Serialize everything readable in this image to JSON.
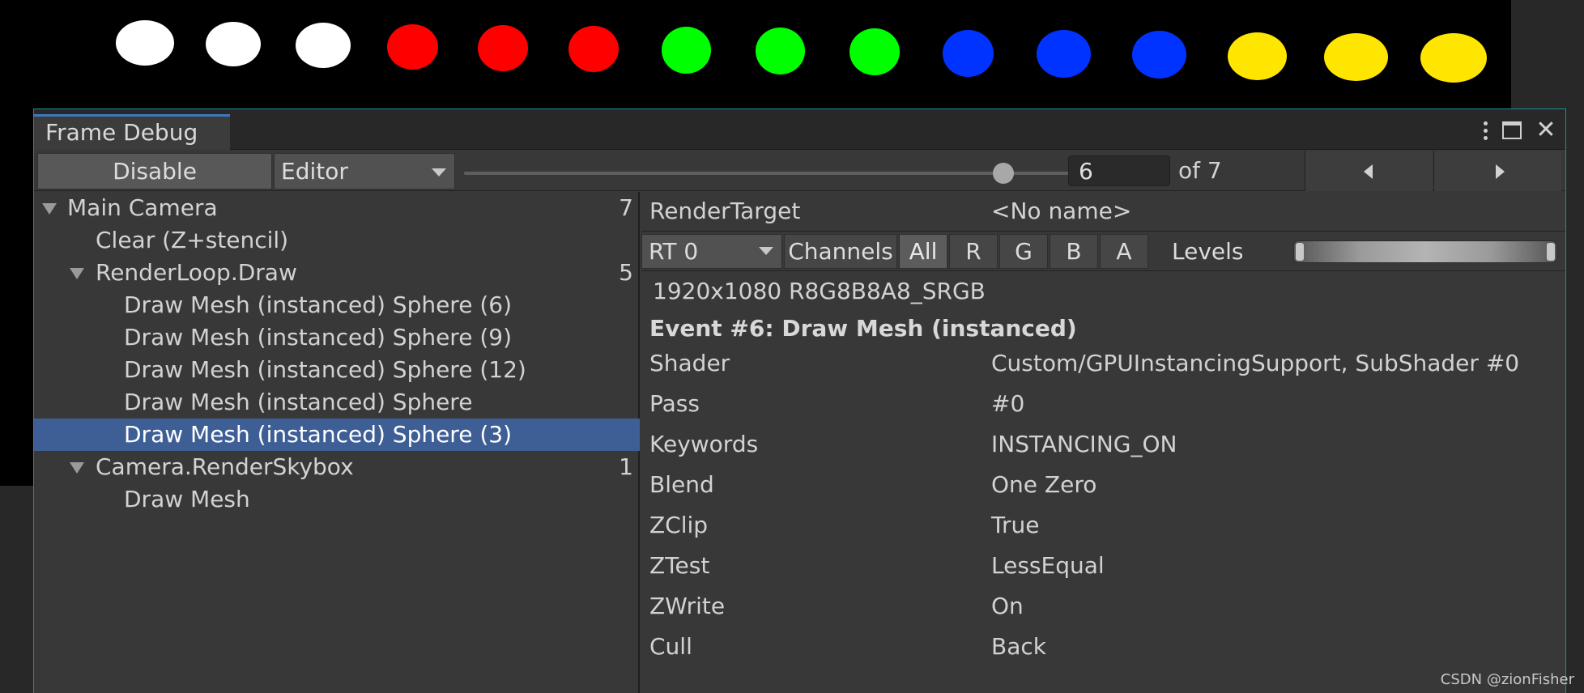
{
  "scene": {
    "ball_colors": [
      "#ffffff",
      "#ffffff",
      "#ffffff",
      "#ff0000",
      "#ff0000",
      "#ff0000",
      "#00ff00",
      "#00ff00",
      "#00ff00",
      "#0033ff",
      "#0033ff",
      "#0033ff",
      "#ffe600",
      "#ffe600",
      "#ffe600"
    ]
  },
  "window": {
    "tab_title": "Frame Debug"
  },
  "toolbar": {
    "disable_label": "Disable",
    "target_value": "Editor",
    "frame_value": "6",
    "frame_progress": 0.86,
    "of_label": "of 7"
  },
  "tree": {
    "rows": [
      {
        "label": "Main Camera",
        "count": "7"
      },
      {
        "label": "Clear (Z+stencil)",
        "count": ""
      },
      {
        "label": "RenderLoop.Draw",
        "count": "5"
      },
      {
        "label": "Draw Mesh (instanced) Sphere (6)",
        "count": ""
      },
      {
        "label": "Draw Mesh (instanced) Sphere (9)",
        "count": ""
      },
      {
        "label": "Draw Mesh (instanced) Sphere (12)",
        "count": ""
      },
      {
        "label": "Draw Mesh (instanced) Sphere",
        "count": ""
      },
      {
        "label": "Draw Mesh (instanced) Sphere (3)",
        "count": ""
      },
      {
        "label": "Camera.RenderSkybox",
        "count": "1"
      },
      {
        "label": "Draw Mesh",
        "count": ""
      }
    ]
  },
  "details": {
    "render_target_label": "RenderTarget",
    "render_target_value": "<No name>",
    "rt_value": "RT 0",
    "channels_label": "Channels",
    "channels": [
      "All",
      "R",
      "G",
      "B",
      "A"
    ],
    "levels_label": "Levels",
    "format": "1920x1080 R8G8B8A8_SRGB",
    "event_title": "Event #6: Draw Mesh (instanced)",
    "properties": [
      {
        "key": "Shader",
        "value": "Custom/GPUInstancingSupport, SubShader #0"
      },
      {
        "key": "Pass",
        "value": "#0"
      },
      {
        "key": "Keywords",
        "value": "INSTANCING_ON"
      },
      {
        "key": "Blend",
        "value": "One Zero"
      },
      {
        "key": "ZClip",
        "value": "True"
      },
      {
        "key": "ZTest",
        "value": "LessEqual"
      },
      {
        "key": "ZWrite",
        "value": "On"
      },
      {
        "key": "Cull",
        "value": "Back"
      }
    ]
  },
  "watermark": "CSDN @zionFisher"
}
